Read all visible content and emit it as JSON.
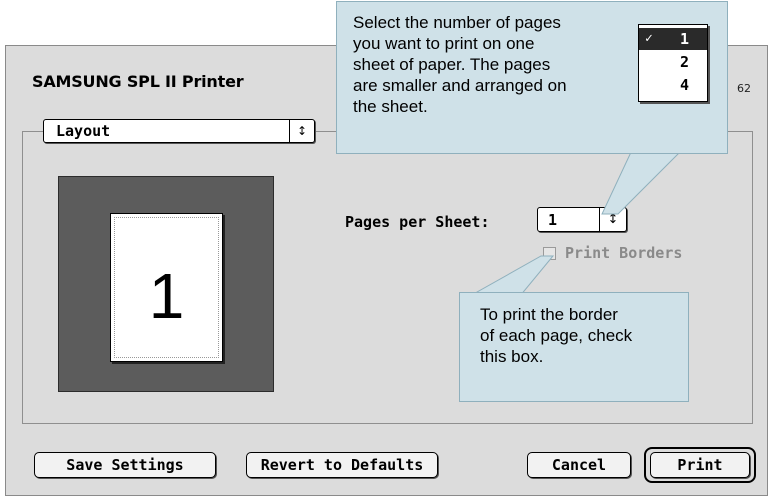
{
  "dialog": {
    "title": "SAMSUNG SPL II Printer",
    "version": "62"
  },
  "popup": {
    "label": "Layout",
    "arrow": "↕"
  },
  "preview": {
    "page_number": "1"
  },
  "pages_per_sheet": {
    "label": "Pages per Sheet:",
    "value": "1",
    "options": [
      "1",
      "2",
      "4"
    ],
    "selected_index": 0
  },
  "print_borders": {
    "label": "Print Borders",
    "checked": false,
    "enabled": false
  },
  "buttons": {
    "save": "Save Settings",
    "revert": "Revert to Defaults",
    "cancel": "Cancel",
    "print": "Print"
  },
  "callouts": {
    "top": "Select the number of pages\nyou want to print on one\nsheet of paper. The pages\nare smaller and arranged on\nthe sheet.",
    "bottom": "To print the border\nof each page, check\nthis box."
  },
  "menu_example": {
    "check_mark": "✓",
    "items": [
      "1",
      "2",
      "4"
    ]
  },
  "colors": {
    "dialog_bg": "#dcdcdc",
    "callout_bg": "#cfe1e8",
    "preview_bg": "#5c5c5c"
  }
}
